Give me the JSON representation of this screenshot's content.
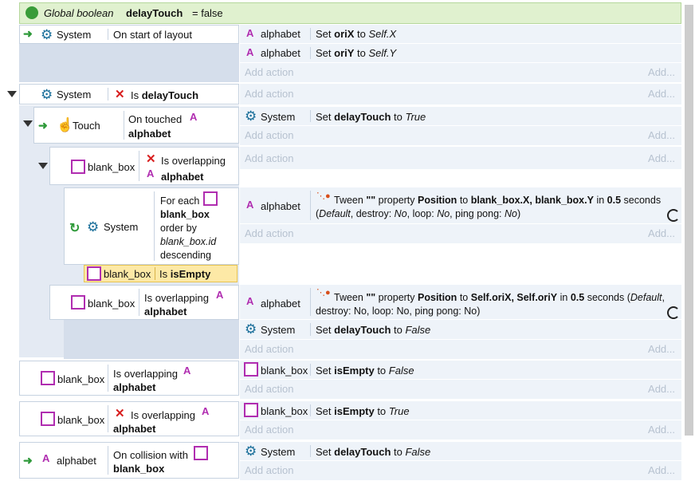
{
  "global_var": {
    "prefix": "Global boolean",
    "name": "delayTouch",
    "suffix": "= false"
  },
  "add_action": "Add action",
  "add_more": "Add...",
  "e1": {
    "object": "System",
    "condition": "On start of layout",
    "actions": [
      {
        "object": "alphabet",
        "text_pre": "Set ",
        "bold": "oriX",
        "text_mid": " to ",
        "italic": "Self.X"
      },
      {
        "object": "alphabet",
        "text_pre": "Set ",
        "bold": "oriY",
        "text_mid": " to ",
        "italic": "Self.Y"
      }
    ]
  },
  "e2": {
    "object": "System",
    "cond_pre": "Is ",
    "cond_bold": "delayTouch"
  },
  "e3": {
    "object": "Touch",
    "cond_line1": "On touched",
    "cond_line2": "alphabet",
    "action": {
      "object": "System",
      "text_pre": "Set ",
      "bold": "delayTouch",
      "text_mid": " to ",
      "italic": "True"
    }
  },
  "e4": {
    "object": "blank_box",
    "cond_line1": "Is overlapping",
    "cond_line2": "alphabet"
  },
  "e5": {
    "object": "System",
    "foreach": {
      "l1": "For each",
      "l2": "blank_box",
      "l3": "order by",
      "l4": "blank_box.id",
      "l5": "descending"
    },
    "sub_cond": {
      "object": "blank_box",
      "pre": "Is ",
      "bold": "isEmpty"
    },
    "action": {
      "object": "alphabet",
      "tween": "Tween",
      "quote": "\"\"",
      "t1": "property",
      "b1": "Position",
      "t2": "to",
      "b2": "blank_box.X, blank_box.Y",
      "t3": "in",
      "b3": "0.5",
      "t4": "seconds",
      "line2_pre": "(",
      "line2_i1": "Default",
      "line2_t": ", destroy: ",
      "line2_i2": "No",
      "line2_t2": ", loop: ",
      "line2_i3": "No",
      "line2_t3": ", ping pong: ",
      "line2_i4": "No",
      "line2_end": ")"
    }
  },
  "e6": {
    "object": "blank_box",
    "cond_line1": "Is overlapping",
    "cond_line2": "alphabet",
    "action1": {
      "object": "alphabet",
      "tween": "Tween",
      "quote": "\"\"",
      "t1": "property",
      "b1": "Position",
      "t2": "to",
      "b2": "Self.oriX, Self.oriY",
      "t3": "in",
      "b3": "0.5",
      "t4": "seconds (",
      "i1": "Default",
      "t5": ",",
      "line2": "destroy: No, loop: No, ping pong: No)"
    },
    "action2": {
      "object": "System",
      "text_pre": "Set ",
      "bold": "delayTouch",
      "text_mid": " to ",
      "italic": "False"
    }
  },
  "e7": {
    "object": "blank_box",
    "cond_line1": "Is overlapping",
    "cond_line2": "alphabet",
    "action": {
      "object": "blank_box",
      "text_pre": "Set ",
      "bold": "isEmpty",
      "text_mid": " to ",
      "italic": "False"
    }
  },
  "e8": {
    "object": "blank_box",
    "cond_line1": "Is overlapping",
    "cond_line2": "alphabet",
    "action": {
      "object": "blank_box",
      "text_pre": "Set ",
      "bold": "isEmpty",
      "text_mid": " to ",
      "italic": "True"
    }
  },
  "e9": {
    "object": "alphabet",
    "cond_line1": "On collision with",
    "cond_line2": "blank_box",
    "action": {
      "object": "System",
      "text_pre": "Set ",
      "bold": "delayTouch",
      "text_mid": " to ",
      "italic": "False"
    }
  },
  "icons": {
    "globe": "globe-icon",
    "gear": "gear-icon",
    "trigger": "trigger-arrow-icon",
    "touch": "touch-hand-icon",
    "alphabet": "sprite-a-icon",
    "box": "sprite-box-icon",
    "invert": "invert-x-icon",
    "loop": "loop-icon",
    "tween": "tween-icon"
  }
}
